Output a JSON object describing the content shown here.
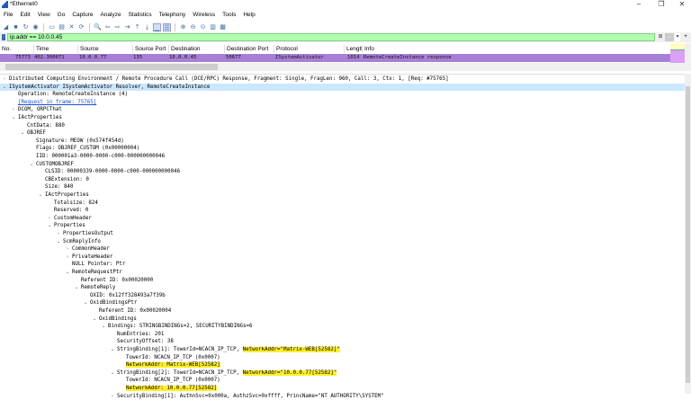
{
  "window": {
    "title": "*Ethernet0",
    "minimize": "–",
    "restore": "❐",
    "close": "✕"
  },
  "menu": [
    "File",
    "Edit",
    "View",
    "Go",
    "Capture",
    "Analyze",
    "Statistics",
    "Telephony",
    "Wireless",
    "Tools",
    "Help"
  ],
  "toolbar_icons": [
    "shark-fin-start-icon",
    "stop-icon",
    "restart-icon",
    "options-icon",
    "open-icon",
    "save-icon",
    "close-file-icon",
    "reload-icon",
    "find-icon",
    "back-icon",
    "forward-icon",
    "goto-icon",
    "first-icon",
    "last-icon",
    "autoscroll-icon",
    "colorize-icon",
    "zoom-in-icon",
    "zoom-out-icon",
    "zoom-reset-icon",
    "resize-columns-icon",
    "layout-icon"
  ],
  "filter": {
    "value": "ip.addr == 10.0.0.45",
    "clear": "⊠",
    "apply": "→",
    "dropdown": "▾",
    "add": "+"
  },
  "packet_list": {
    "columns": [
      "No.",
      "Time",
      "Source",
      "Source Port",
      "Destination",
      "Destination Port",
      "Protocol",
      "Length",
      "Info"
    ],
    "rows": [
      {
        "no": "75773",
        "time": "402.300071",
        "source": "10.0.0.77",
        "sport": "135",
        "destination": "10.0.0.45",
        "dport": "50677",
        "protocol": "ISystemActivator",
        "length": "1014",
        "info": "RemoteCreateInstance response"
      }
    ]
  },
  "details": [
    {
      "level": 0,
      "exp": "c",
      "text": "Distributed Computing Environment / Remote Procedure Call (DCE/RPC) Response, Fragment: Single, FragLen: 960, Call: 3, Ctx: 1, [Req: #75765]"
    },
    {
      "level": 0,
      "exp": "o",
      "text": "ISystemActivator ISystemActivator Resolver, RemoteCreateInstance",
      "selected": true
    },
    {
      "level": 1,
      "text": "Operation: RemoteCreateInstance (4)"
    },
    {
      "level": 1,
      "text": "[Request in frame: 75765]",
      "link": true
    },
    {
      "level": 1,
      "exp": "c",
      "text": "DCOM, ORPCThat"
    },
    {
      "level": 1,
      "exp": "o",
      "text": "IActProperties"
    },
    {
      "level": 2,
      "text": "CntData: 880"
    },
    {
      "level": 2,
      "exp": "o",
      "text": "OBJREF"
    },
    {
      "level": 3,
      "text": "Signature: MEOW (0x574f454d)"
    },
    {
      "level": 3,
      "text": "Flags: OBJREF_CUSTOM (0x00000004)"
    },
    {
      "level": 3,
      "text": "IID: 000001a3-0000-0000-c000-000000000046"
    },
    {
      "level": 3,
      "exp": "o",
      "text": "CUSTOMOBJREF"
    },
    {
      "level": 4,
      "text": "CLSID: 00000339-0000-0000-c000-000000000046"
    },
    {
      "level": 4,
      "text": "CBExtension: 0"
    },
    {
      "level": 4,
      "text": "Size: 840"
    },
    {
      "level": 4,
      "exp": "o",
      "text": "IActProperties"
    },
    {
      "level": 5,
      "text": "Totalsize: 824"
    },
    {
      "level": 5,
      "text": "Reserved: 0"
    },
    {
      "level": 5,
      "exp": "c",
      "text": "CustomHeader"
    },
    {
      "level": 5,
      "exp": "o",
      "text": "Properties"
    },
    {
      "level": 6,
      "exp": "c",
      "text": "PropertiesOutput"
    },
    {
      "level": 6,
      "exp": "o",
      "text": "ScmReplyInfo"
    },
    {
      "level": 7,
      "exp": "c",
      "text": "CommonHeader"
    },
    {
      "level": 7,
      "exp": "c",
      "text": "PrivateHeader"
    },
    {
      "level": 7,
      "text": "NULL Pointer: Ptr"
    },
    {
      "level": 7,
      "exp": "o",
      "text": "RemoteRequestPtr"
    },
    {
      "level": 8,
      "text": "Referent ID: 0x00020000"
    },
    {
      "level": 8,
      "exp": "o",
      "text": "RemoteReply"
    },
    {
      "level": 9,
      "text": "OXID: 0x12ff328493a7f39b"
    },
    {
      "level": 9,
      "exp": "o",
      "text": "OxidBindingsPtr"
    },
    {
      "level": 10,
      "text": "Referent ID: 0x00020004"
    },
    {
      "level": 10,
      "exp": "o",
      "text": "OxidBindings"
    },
    {
      "level": 11,
      "exp": "o",
      "text": "Bindings: STRINGBINDINGs=2, SECURITYBINDINGs=6"
    },
    {
      "level": 12,
      "text": "NumEntries: 201"
    },
    {
      "level": 12,
      "text": "SecurityOffset: 38"
    },
    {
      "level": 12,
      "exp": "o",
      "text": "StringBinding[1]: TowerId=NCACN_IP_TCP, ",
      "hl_text": "NetworkAddr=\"Matrix-WEB[52582]\""
    },
    {
      "level": 13,
      "text": "TowerId: NCACN_IP_TCP (0x0007)"
    },
    {
      "level": 13,
      "text": "",
      "hl_text": "NetworkAddr: Matrix-WEB[52582]"
    },
    {
      "level": 12,
      "exp": "o",
      "text": "StringBinding[2]: TowerId=NCACN_IP_TCP, ",
      "hl_text": "NetworkAddr=\"10.0.0.77[52582]\""
    },
    {
      "level": 13,
      "text": "TowerId: NCACN_IP_TCP (0x0007)"
    },
    {
      "level": 13,
      "text": "",
      "hl_text": "NetworkAddr: 10.0.0.77[52582]"
    },
    {
      "level": 12,
      "exp": "c",
      "text": "SecurityBinding[1]: AuthnSvc=0x000a, AuthzSvc=0xffff, PrincName=\"NT AUTHORITY\\SYSTEM\""
    }
  ],
  "colors": {
    "filter_ok": "#afffaf",
    "row": "#a77fd6",
    "selected": "#cce8ff",
    "highlight": "#ffef28"
  }
}
